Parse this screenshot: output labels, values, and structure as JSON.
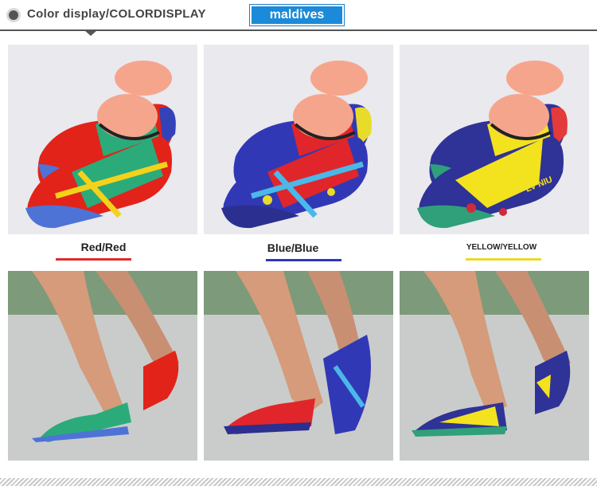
{
  "header": {
    "title": "Color display/COLORDISPLAY",
    "brand": "maldives"
  },
  "variants": [
    {
      "label": "Red/Red",
      "accent": "#e02b2b",
      "upper": "#2bab7a",
      "wrap": "#e2231a",
      "stripe": "#f5d21a",
      "sole": "#4e73d6",
      "heel": "#3342b8"
    },
    {
      "label": "Blue/Blue",
      "accent": "#2f38b8",
      "upper": "#e0262a",
      "wrap": "#3138b6",
      "stripe": "#4ab8e8",
      "sole": "#2b2f8f",
      "heel": "#e8dc2a"
    },
    {
      "label": "YELLOW/YELLOW",
      "accent": "#eadb2a",
      "upper": "#f3e21e",
      "wrap": "#2f3296",
      "stripe": "#d12a3a",
      "sole": "#2fa07a",
      "heel": "#e33a3a"
    }
  ],
  "shoe_print": "LV NIU"
}
